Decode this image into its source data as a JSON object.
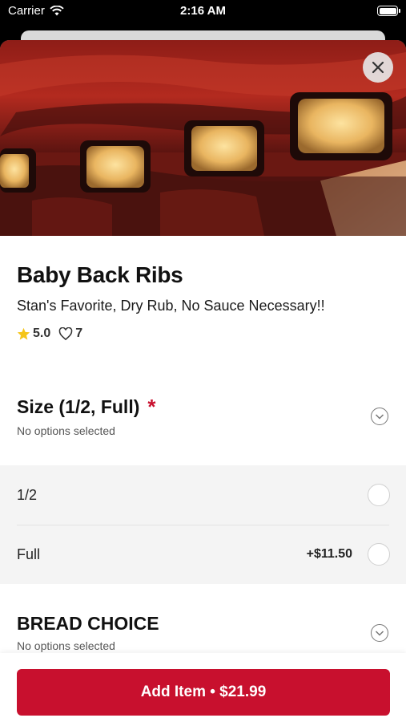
{
  "status_bar": {
    "carrier": "Carrier",
    "time": "2:16 AM"
  },
  "item": {
    "name": "Baby Back Ribs",
    "description": "Stan's Favorite, Dry Rub, No Sauce Necessary!!",
    "rating": "5.0",
    "likes": "7"
  },
  "size_section": {
    "title": "Size (1/2, Full)",
    "required_marker": "*",
    "subtitle": "No options selected",
    "options": [
      {
        "label": "1/2",
        "price": ""
      },
      {
        "label": "Full",
        "price": "+$11.50"
      }
    ]
  },
  "bread_section": {
    "title": "BREAD CHOICE",
    "subtitle": "No options selected"
  },
  "footer": {
    "add_button_label": "Add Item • $21.99"
  },
  "colors": {
    "accent": "#c8102e",
    "star": "#f5c518"
  }
}
